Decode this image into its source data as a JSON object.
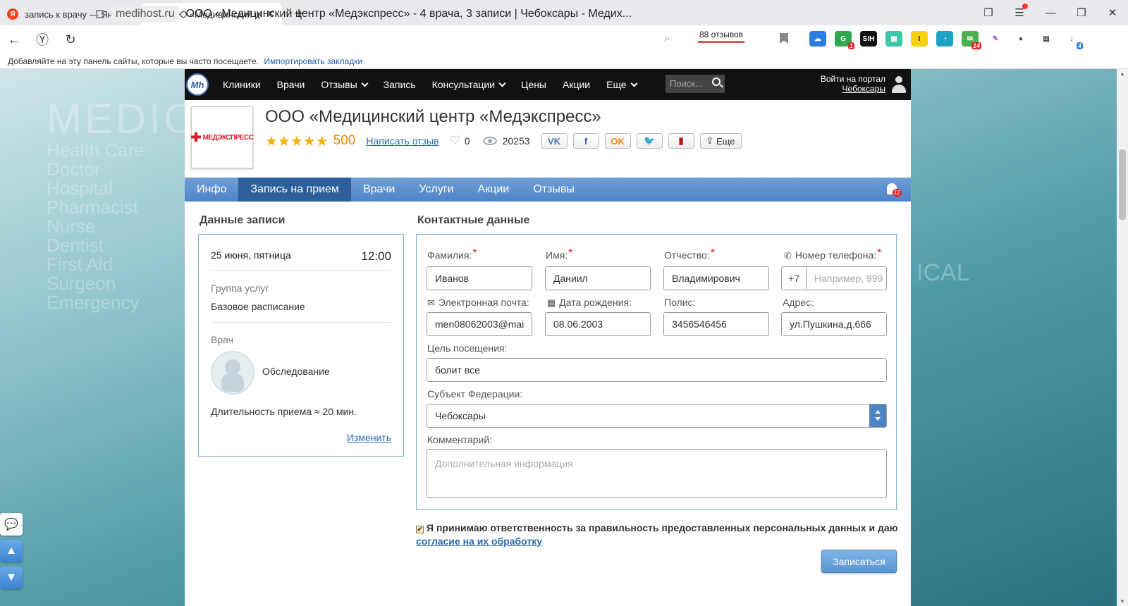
{
  "browser": {
    "tabs": [
      {
        "label": "запись к врачу — Яндекс"
      },
      {
        "label": "ООО «Медицинский це"
      }
    ],
    "domain": "medihost.ru",
    "page_title": "ООО «Медицинский центр «Медэкспресс» - 4 врача, 3 записи | Чебоксары - Медих...",
    "reviews_chip": "88 отзывов",
    "bookmarks_bar_text": "Добавляйте на эту панель сайты, которые вы часто посещаете.",
    "bookmarks_bar_link": "Импортировать закладки",
    "ext_badges": {
      "first": "1",
      "second": "14",
      "download": "4"
    }
  },
  "site": {
    "logo_text": "Mh",
    "nav": [
      {
        "label": "Клиники"
      },
      {
        "label": "Врачи"
      },
      {
        "label": "Отзывы"
      },
      {
        "label": "Запись"
      },
      {
        "label": "Консультации"
      },
      {
        "label": "Цены"
      },
      {
        "label": "Акции"
      },
      {
        "label": "Еще"
      }
    ],
    "search_placeholder": "Поиск...",
    "login_label": "Войти на портал",
    "city": "Чебоксары"
  },
  "clinic": {
    "logo_text": "МЕДЭКСПРЕСС",
    "title": "ООО «Медицинский центр «Медэкспресс»",
    "stars": "★★★★★",
    "rating": "500",
    "write_review": "Написать отзыв",
    "likes": "0",
    "views": "20253",
    "share_more": "Еще"
  },
  "subnav": {
    "items": [
      {
        "label": "Инфо"
      },
      {
        "label": "Запись на прием"
      },
      {
        "label": "Врачи"
      },
      {
        "label": "Услуги"
      },
      {
        "label": "Акции"
      },
      {
        "label": "Отзывы"
      }
    ],
    "active_index": 1,
    "notifications": "12"
  },
  "booking": {
    "left_title": "Данные записи",
    "date": "25 июня, пятница",
    "time": "12:00",
    "group_label": "Группа услуг",
    "group_value": "Базовое расписание",
    "doctor_label": "Врач",
    "doctor_value": "Обследование",
    "duration": "Длительность приема ≈ 20 мин.",
    "change_link": "Изменить"
  },
  "contact": {
    "title": "Контактные данные",
    "surname_label": "Фамилия:",
    "surname_value": "Иванов",
    "name_label": "Имя:",
    "name_value": "Даниил",
    "patronymic_label": "Отчество:",
    "patronymic_value": "Владимирович",
    "phone_label": "Номер телефона:",
    "phone_prefix": "+7",
    "phone_placeholder": "Например, 999",
    "email_label": "Электронная почта:",
    "email_value": "men08062003@mai",
    "birth_label": "Дата рождения:",
    "birth_value": "08.06.2003",
    "policy_label": "Полис:",
    "policy_value": "3456546456",
    "address_label": "Адрес:",
    "address_value": "ул.Пушкина,д.666",
    "purpose_label": "Цель посещения:",
    "purpose_value": "болит все",
    "region_label": "Субъект Федерации:",
    "region_value": "Чебоксары",
    "comment_label": "Комментарий:",
    "comment_placeholder": "Дополнительная информация"
  },
  "consent": {
    "text": "Я принимаю ответственность за правильность предоставленных персональных данных и даю",
    "link": "согласие на их обработку",
    "checked": true
  },
  "submit_label": "Записаться",
  "background": {
    "words_big": "MEDIC",
    "words": [
      "Health Care",
      "Doctor",
      "Hospital",
      "Pharmacist",
      "Nurse",
      "Dentist",
      "First Aid",
      "Surgeon",
      "Emergency"
    ],
    "right_word": "ICAL"
  },
  "colors": {
    "accent": "#4f83c4",
    "active_tab": "#2c5f9c",
    "rating": "#e28b00",
    "required": "#e02424"
  }
}
